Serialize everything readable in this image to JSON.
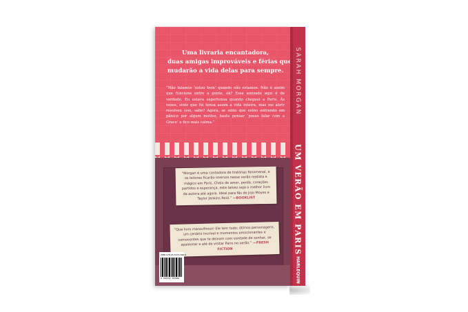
{
  "back_cover": {
    "tagline": [
      "Uma livraria encantadora,",
      "duas amigas improváveis e férias que",
      "mudarão a vida delas para sempre."
    ],
    "blurb": "“Não falamos ‘estou bem’ quando não estamos. Não é assim que funciona entre a gente, ok? Essa amizade aqui é de verdade. Eu estava supertensa quando cheguei a Paris. Às vezes, sinto que fui tensa assim a vida inteira, mas me abrir resolveu isso, sabe? Agora, se sinto que estou entrando em pânico por algum motivo, basta pensar ‘posso falar com a Grace’ e fico mais calma.”",
    "review_1": {
      "text": "“Morgan é uma contadora de histórias fenomenal, e os leitores ficarão imersos nesse verão realista e mágico em Paris. Cheio de amor, perda, corações partidos e esperança, este talvez seja o melhor livro da autora até agora. Ideal para fãs de Jojo Moyes e Taylor Jenkins Reid.”",
      "source": "—BOOKLIST"
    },
    "review_2": {
      "text": "“Que livro maravilhoso! Ele tem tudo: ótimos personagens, um cenário incrível e momentos emocionantes e comoventes que te deixam com vontade de sonhar, se apaixonar e até de visitar Paris no verão.”",
      "source": "—FRESH FICTION"
    },
    "isbn": "ISBN 978-65-5970-396-6",
    "barcode_digits": "9 786559 703966"
  },
  "spine": {
    "author": "SARAH MORGAN",
    "title": "UM VERÃO EM PARIS",
    "publisher": "HARLEQUIN"
  },
  "colors": {
    "cover_pink": "#e9566a",
    "spine_red": "#c2324a",
    "shop_plum": "#7a3f52",
    "note_paper": "#efe6d4"
  }
}
